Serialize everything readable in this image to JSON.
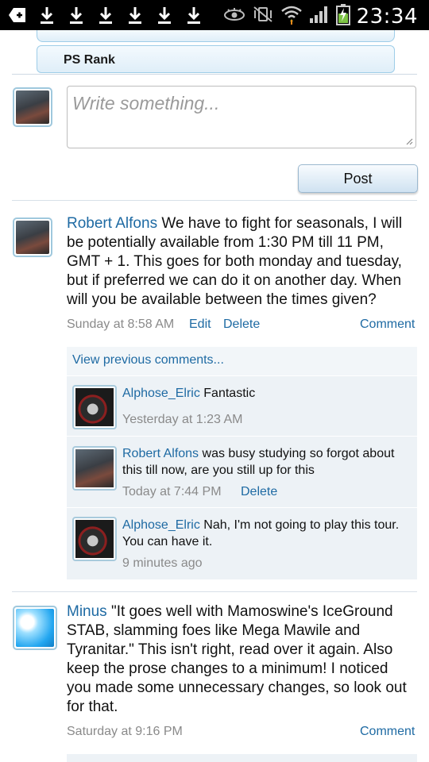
{
  "status_bar": {
    "time": "23:34"
  },
  "menu": {
    "ps_rank_label": "PS Rank"
  },
  "composer": {
    "placeholder": "Write something...",
    "post_label": "Post"
  },
  "posts": [
    {
      "author": "Robert Alfons",
      "text": "We have to fight for seasonals, I will be potentially available from 1:30 PM till 11 PM, GMT + 1. This goes for both monday and tuesday, but if preferred we can do it on another day. When will you be available between the times given?",
      "time": "Sunday at 8:58 AM",
      "edit_label": "Edit",
      "delete_label": "Delete",
      "comment_label": "Comment",
      "view_previous": "View previous comments...",
      "comments": [
        {
          "author": "Alphose_Elric",
          "text": "Fantastic",
          "time": "Yesterday at 1:23 AM"
        },
        {
          "author": "Robert Alfons",
          "text": "was busy studying so forgot about this till now, are you still up for this",
          "time": "Today at 7:44 PM",
          "delete_label": "Delete"
        },
        {
          "author": "Alphose_Elric",
          "text": "Nah, I'm not going to play this tour. You can have it.",
          "time": "9 minutes ago"
        }
      ]
    },
    {
      "author": "Minus",
      "text": "\"It goes well with Mamoswine's IceGround STAB, slamming foes like Mega Mawile and Tyranitar.\" This isn't right, read over it again. Also keep the prose changes to a minimum! I noticed you made some unnecessary changes, so look out for that.",
      "time": "Saturday at 9:16 PM",
      "comment_label": "Comment"
    }
  ]
}
